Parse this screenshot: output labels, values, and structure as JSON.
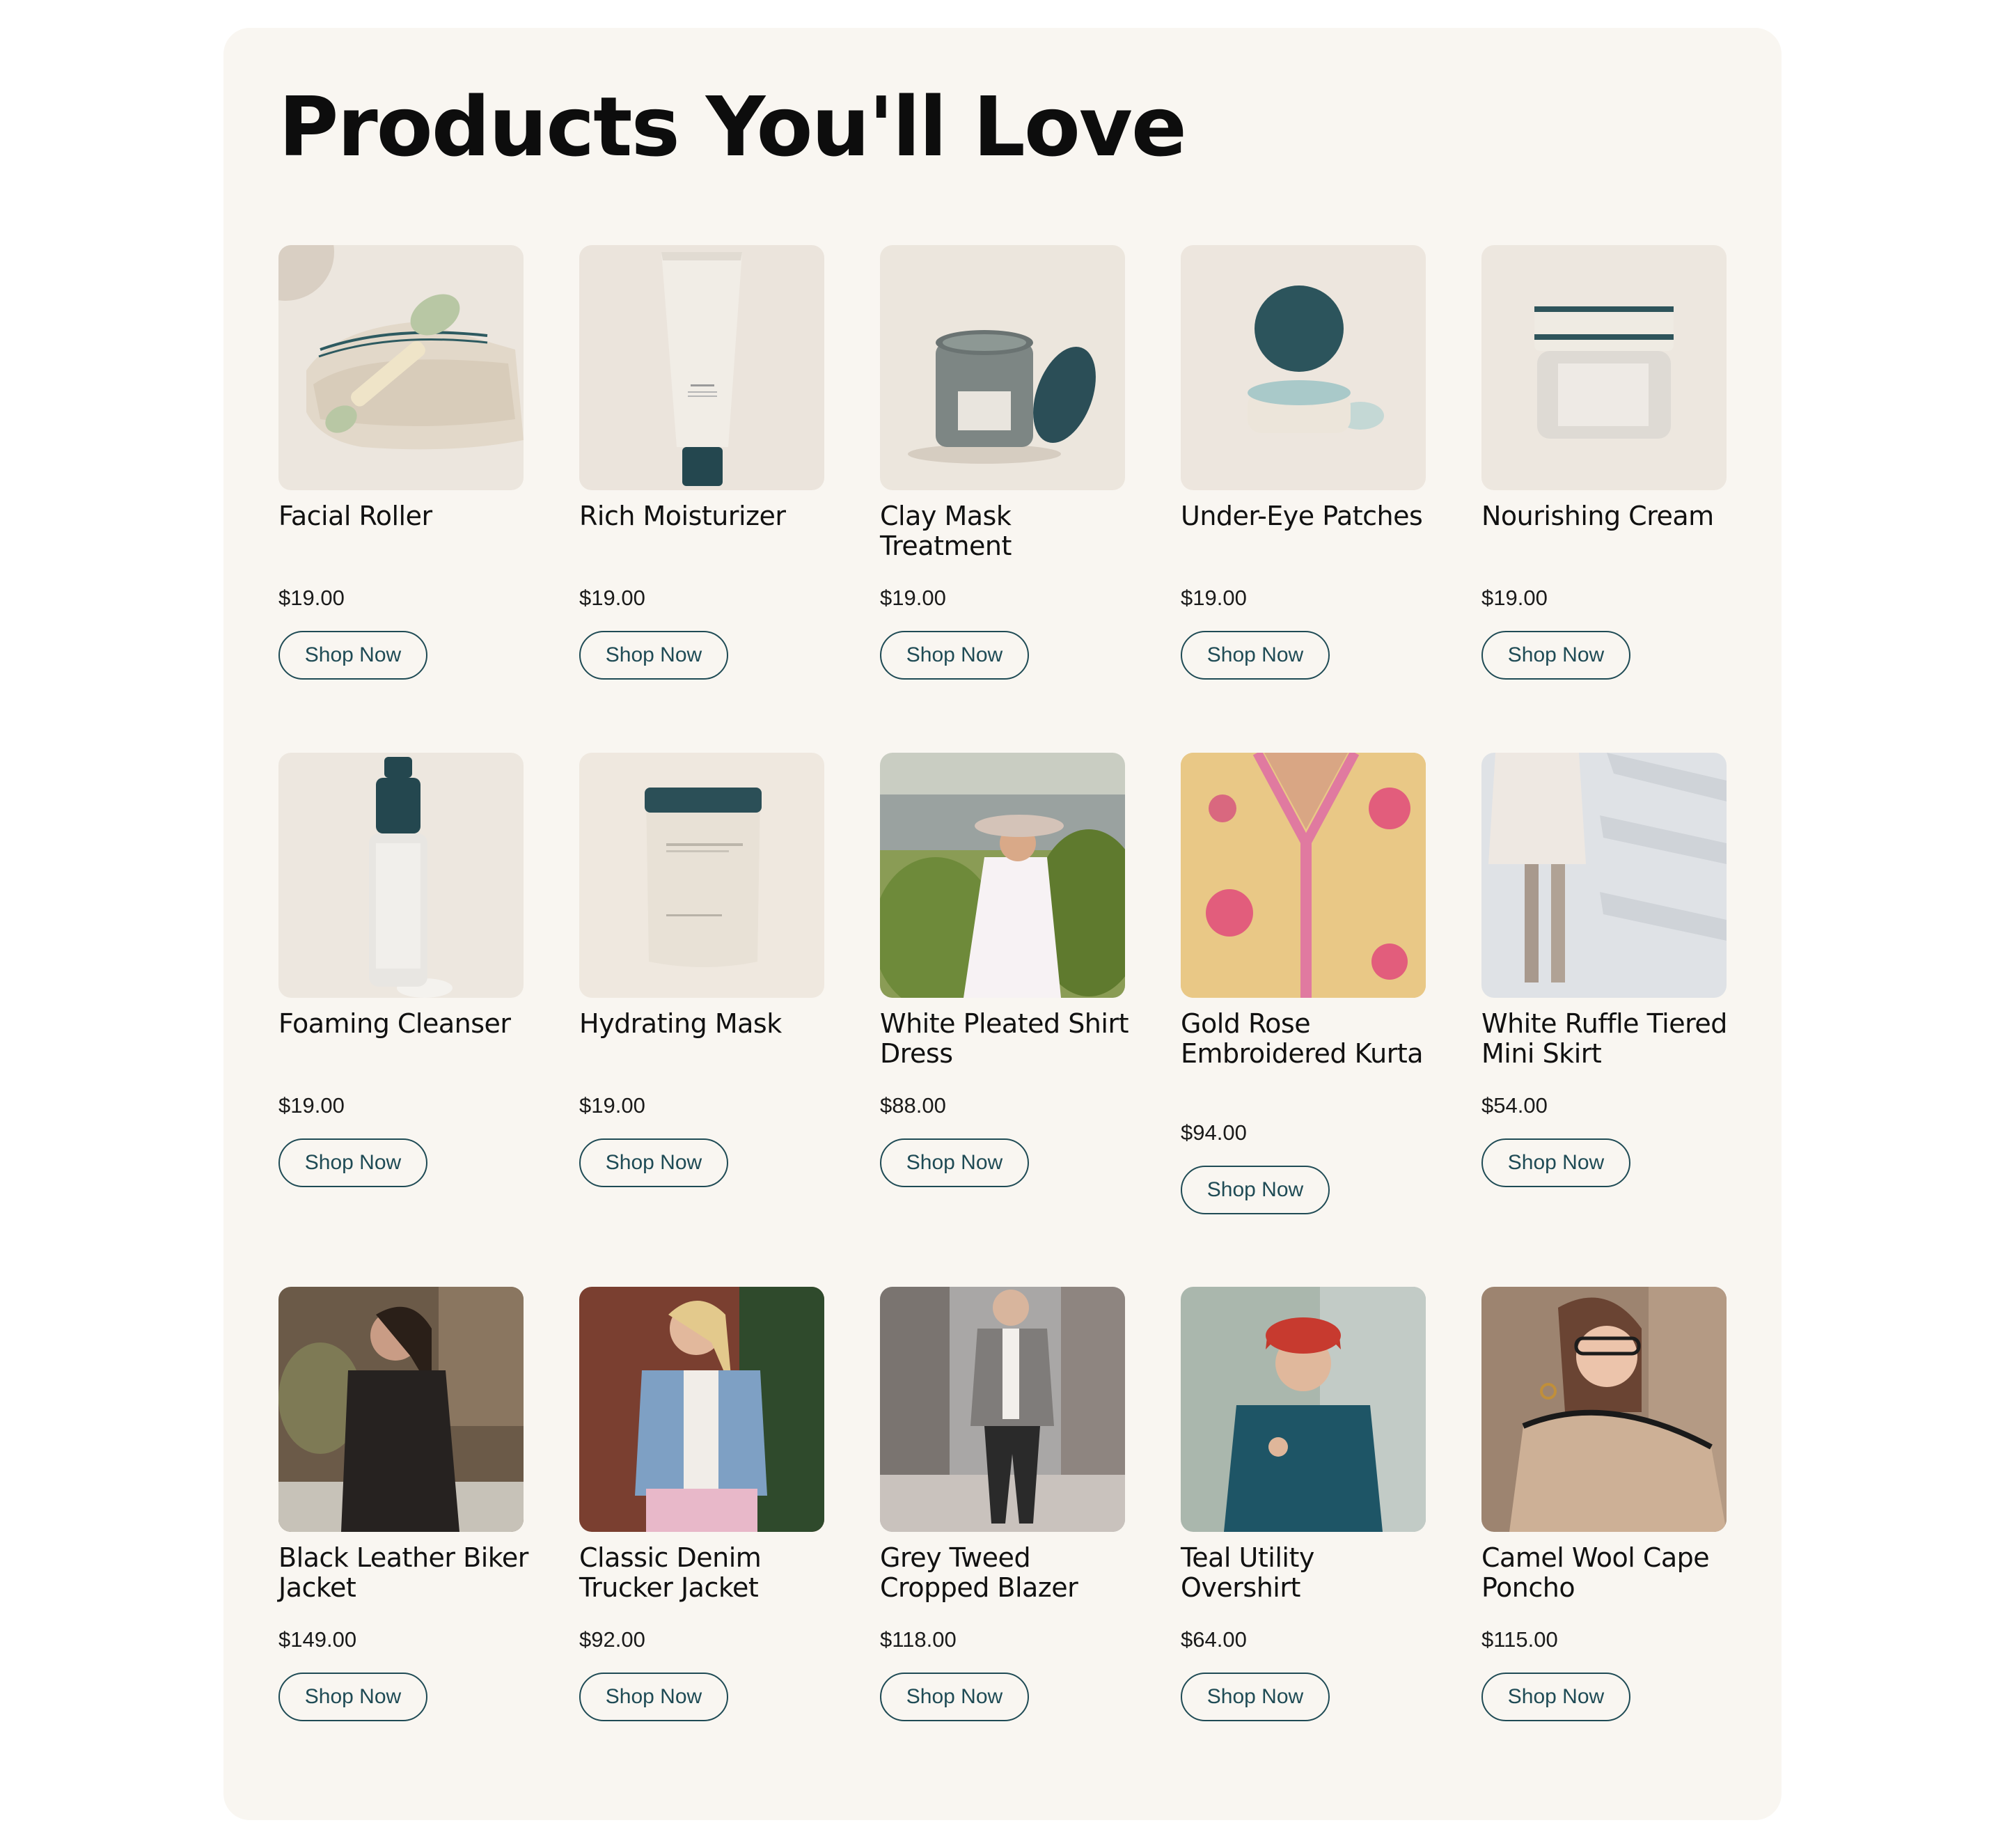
{
  "section": {
    "title": "Products You'll Love"
  },
  "colors": {
    "panel_background": "#f9f6f1",
    "button_outline": "#1f4b55",
    "title_text": "#0d0d0d"
  },
  "products": [
    {
      "name": "Facial Roller",
      "price": "$19.00",
      "cta": "Shop Now"
    },
    {
      "name": "Rich Moisturizer",
      "price": "$19.00",
      "cta": "Shop Now"
    },
    {
      "name": "Clay Mask Treatment",
      "price": "$19.00",
      "cta": "Shop Now"
    },
    {
      "name": "Under-Eye Patches",
      "price": "$19.00",
      "cta": "Shop Now"
    },
    {
      "name": "Nourishing Cream",
      "price": "$19.00",
      "cta": "Shop Now"
    },
    {
      "name": "Foaming Cleanser",
      "price": "$19.00",
      "cta": "Shop Now"
    },
    {
      "name": "Hydrating Mask",
      "price": "$19.00",
      "cta": "Shop Now"
    },
    {
      "name": "White Pleated Shirt Dress",
      "price": "$88.00",
      "cta": "Shop Now"
    },
    {
      "name": "Gold Rose Embroidered Kurta",
      "price": "$94.00",
      "cta": "Shop Now"
    },
    {
      "name": "White Ruffle Tiered Mini Skirt",
      "price": "$54.00",
      "cta": "Shop Now"
    },
    {
      "name": "Black Leather Biker Jacket",
      "price": "$149.00",
      "cta": "Shop Now"
    },
    {
      "name": "Classic Denim Trucker Jacket",
      "price": "$92.00",
      "cta": "Shop Now"
    },
    {
      "name": "Grey Tweed Cropped Blazer",
      "price": "$118.00",
      "cta": "Shop Now"
    },
    {
      "name": "Teal Utility Overshirt",
      "price": "$64.00",
      "cta": "Shop Now"
    },
    {
      "name": "Camel Wool Cape Poncho",
      "price": "$115.00",
      "cta": "Shop Now"
    }
  ]
}
